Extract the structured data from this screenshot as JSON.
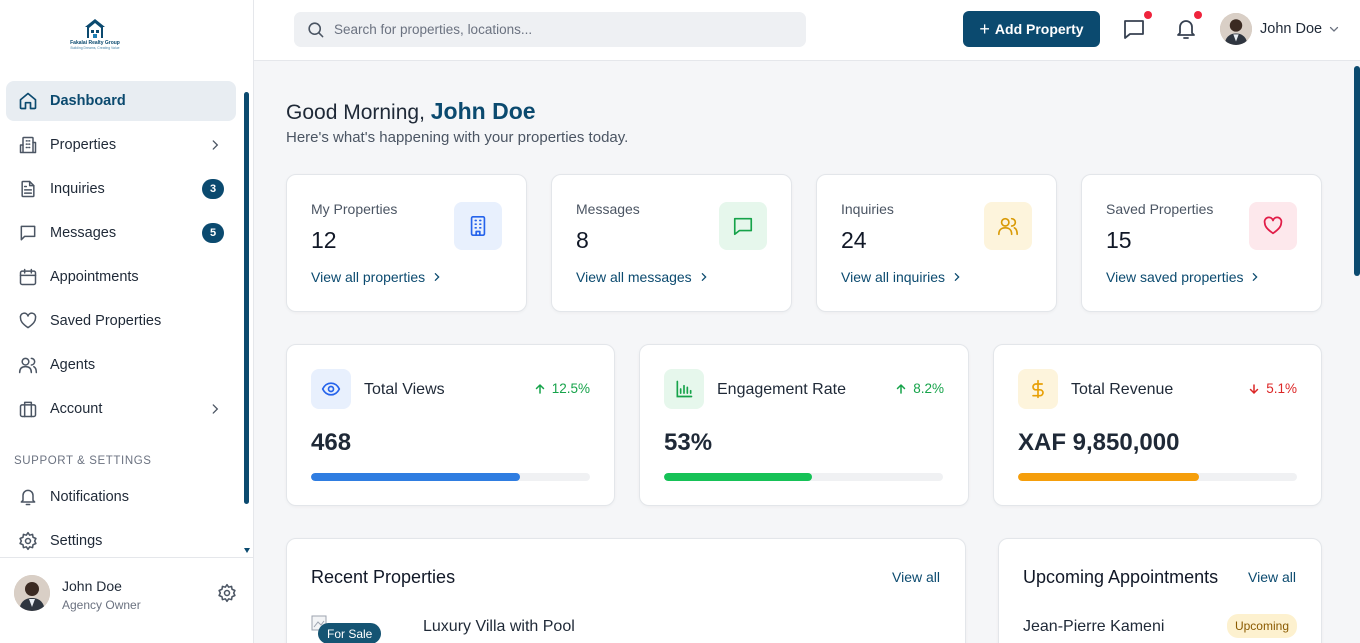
{
  "brand": {
    "name": "Fakalai Realty Group",
    "tagline": "Building Dreams, Creating Value"
  },
  "search": {
    "placeholder": "Search for properties, locations..."
  },
  "topbar": {
    "add_label": "Add Property",
    "user_name": "John Doe"
  },
  "sidebar": {
    "items": [
      {
        "label": "Dashboard",
        "icon": "home-icon",
        "active": true
      },
      {
        "label": "Properties",
        "icon": "building-icon",
        "chevron": true
      },
      {
        "label": "Inquiries",
        "icon": "document-icon",
        "badge": "3"
      },
      {
        "label": "Messages",
        "icon": "message-icon",
        "badge": "5"
      },
      {
        "label": "Appointments",
        "icon": "calendar-icon"
      },
      {
        "label": "Saved Properties",
        "icon": "heart-icon"
      },
      {
        "label": "Agents",
        "icon": "users-icon"
      },
      {
        "label": "Account",
        "icon": "briefcase-icon",
        "chevron": true
      }
    ],
    "section_title": "SUPPORT & SETTINGS",
    "support_items": [
      {
        "label": "Notifications",
        "icon": "bell-icon"
      },
      {
        "label": "Settings",
        "icon": "gear-icon"
      }
    ],
    "user": {
      "name": "John Doe",
      "role": "Agency Owner"
    }
  },
  "greeting": {
    "prefix": "Good Morning,",
    "name": "John Doe",
    "subtitle": "Here's what's happening with your properties today."
  },
  "stats": [
    {
      "label": "My Properties",
      "value": "12",
      "link": "View all properties",
      "icon": "building-icon",
      "color": "#2563eb",
      "bg": "#e8f0fd"
    },
    {
      "label": "Messages",
      "value": "8",
      "link": "View all messages",
      "icon": "message-icon",
      "color": "#16a34a",
      "bg": "#e6f7ec"
    },
    {
      "label": "Inquiries",
      "value": "24",
      "link": "View all inquiries",
      "icon": "users-icon",
      "color": "#d99a06",
      "bg": "#fdf4dc"
    },
    {
      "label": "Saved Properties",
      "value": "15",
      "link": "View saved properties",
      "icon": "heart-icon",
      "color": "#e11d48",
      "bg": "#fde8ec"
    }
  ],
  "metrics": [
    {
      "label": "Total Views",
      "value": "468",
      "trend": "12.5%",
      "direction": "up",
      "progress": 0.75,
      "color": "#2f7de1",
      "icon": "eye-icon",
      "icon_bg": "#e8f0fd"
    },
    {
      "label": "Engagement Rate",
      "value": "53%",
      "trend": "8.2%",
      "direction": "up",
      "progress": 0.53,
      "color": "#16c257",
      "icon": "bar-chart-icon",
      "icon_bg": "#e6f7ec"
    },
    {
      "label": "Total Revenue",
      "value": "XAF 9,850,000",
      "trend": "5.1%",
      "direction": "down",
      "progress": 0.65,
      "color": "#f59e0b",
      "icon": "dollar-icon",
      "icon_bg": "#fdf4dc"
    }
  ],
  "recent": {
    "title": "Recent Properties",
    "view_all": "View all",
    "item_title": "Luxury Villa with Pool",
    "item_badge": "For Sale"
  },
  "appointments": {
    "title": "Upcoming Appointments",
    "view_all": "View all",
    "item_name": "Jean-Pierre Kameni",
    "item_status": "Upcoming"
  },
  "colors": {
    "accent": "#0b4a6f",
    "up": "#16a34a",
    "down": "#dc2626",
    "notification": "#ef233c"
  }
}
